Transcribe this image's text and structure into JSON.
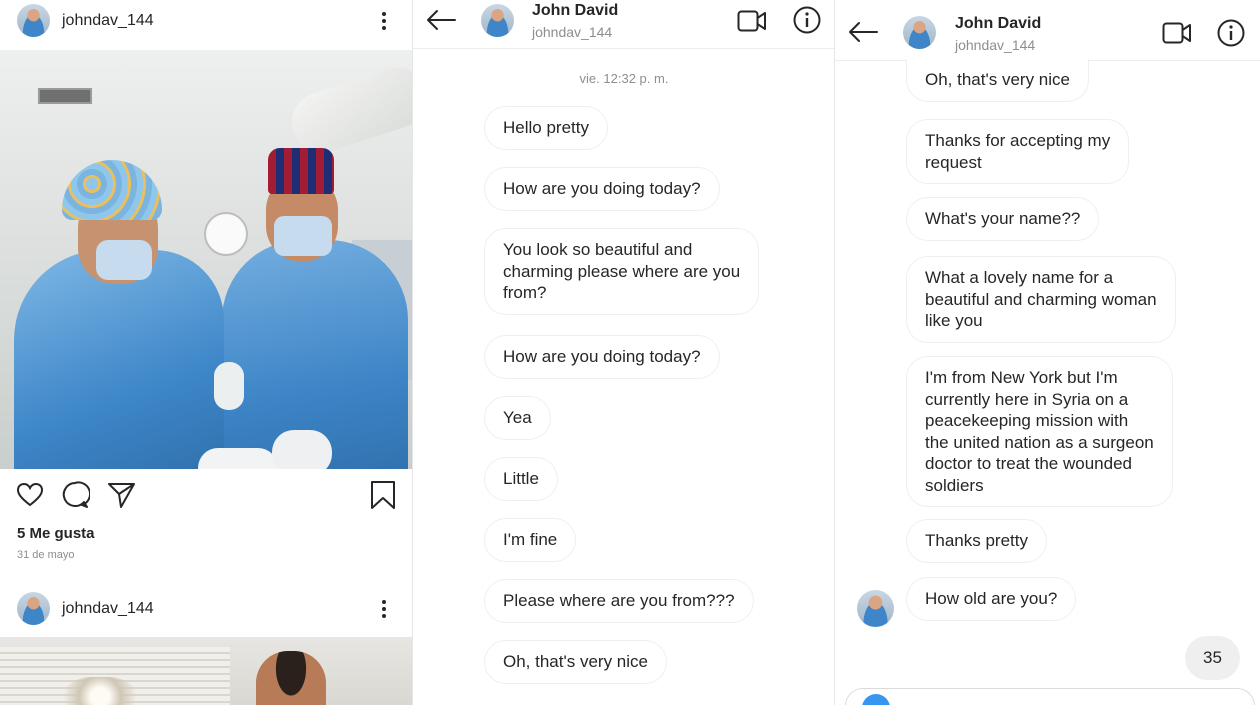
{
  "feed": {
    "post1": {
      "username": "johndav_144",
      "likes": "5 Me gusta",
      "date": "31 de mayo"
    },
    "post2": {
      "username": "johndav_144"
    },
    "icons": [
      "heart-icon",
      "comment-icon",
      "send-icon",
      "bookmark-icon",
      "more-options-icon"
    ]
  },
  "chat1": {
    "header": {
      "name": "John David",
      "username": "johndav_144"
    },
    "timestamp": "vie. 12:32 p. m.",
    "messages": [
      "Hello pretty",
      "How are you doing today?",
      "You look so beautiful and\ncharming please where are you\nfrom?",
      "How are you doing today?",
      "Yea",
      "Little",
      "I'm fine",
      "Please where are you from???",
      "Oh, that's very nice"
    ]
  },
  "chat2": {
    "header": {
      "name": "John David",
      "username": "johndav_144"
    },
    "messages": [
      "Oh, that's very nice",
      "Thanks for accepting my\nrequest",
      "What's your name??",
      "What a lovely name for a\nbeautiful and charming woman\nlike you",
      "I'm from New York but I'm\ncurrently here in Syria on a\npeacekeeping mission with\nthe united nation as a surgeon\ndoctor to treat the wounded\nsoldiers",
      "Thanks pretty",
      "How old are you?"
    ],
    "reply": "35"
  },
  "colors": {
    "bubble_border": "#efefef",
    "own_bubble": "#efefef",
    "accent": "#3797f0",
    "text": "#262626",
    "muted": "#8e8e8e"
  }
}
